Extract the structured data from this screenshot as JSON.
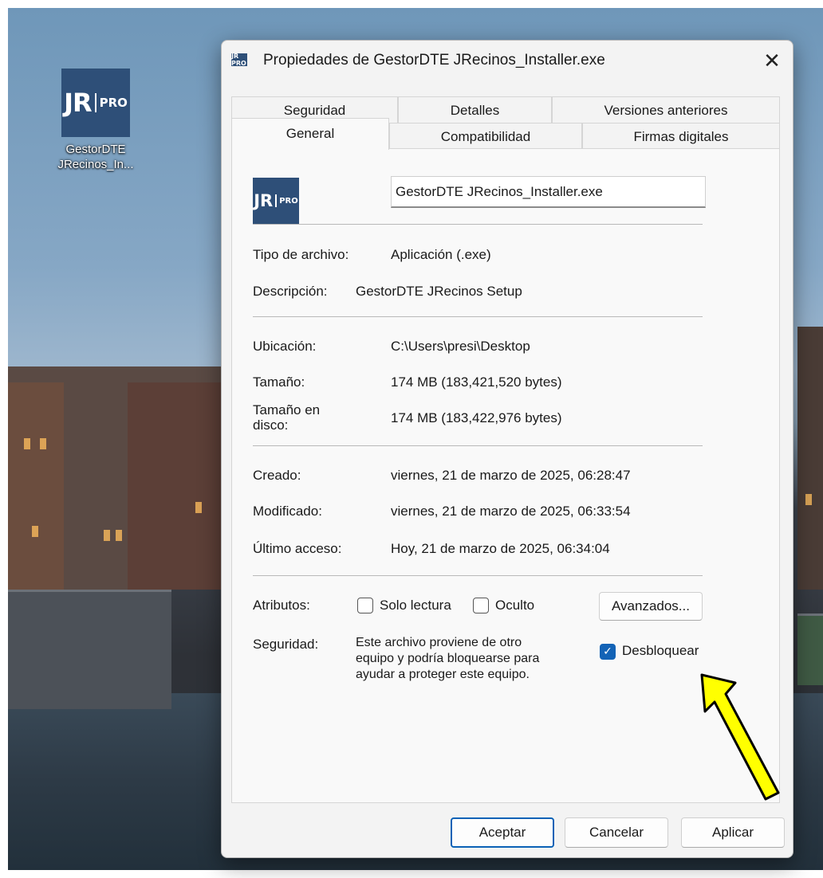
{
  "desktop": {
    "icon_tile": {
      "jr": "JR",
      "pro": "PRO"
    },
    "icon_label_line1": "GestorDTE",
    "icon_label_line2": "JRecinos_In..."
  },
  "dialog": {
    "title": "Propiedades de GestorDTE JRecinos_Installer.exe",
    "app_icon": "JR PRO",
    "close_glyph": "✕",
    "tabs_row1": [
      "Seguridad",
      "Detalles",
      "Versiones anteriores"
    ],
    "tabs_row2": [
      "General",
      "Compatibilidad",
      "Firmas digitales"
    ],
    "active_tab": "General",
    "general": {
      "file_icon": {
        "jr": "JR",
        "pro": "PRO"
      },
      "file_name": "GestorDTE JRecinos_Installer.exe",
      "type_label": "Tipo de archivo:",
      "type_value": "Aplicación (.exe)",
      "desc_label": "Descripción:",
      "desc_value": "GestorDTE JRecinos Setup",
      "location_label": "Ubicación:",
      "location_value": "C:\\Users\\presi\\Desktop",
      "size_label": "Tamaño:",
      "size_value": "174 MB (183,421,520 bytes)",
      "disk_size_label_1": "Tamaño en",
      "disk_size_label_2": "disco:",
      "disk_size_value": "174 MB (183,422,976 bytes)",
      "created_label": "Creado:",
      "created_value": "viernes, 21 de marzo de 2025, 06:28:47",
      "modified_label": "Modificado:",
      "modified_value": "viernes, 21 de marzo de 2025, 06:33:54",
      "accessed_label": "Último acceso:",
      "accessed_value": "Hoy, 21 de marzo de 2025, 06:34:04",
      "attributes_label": "Atributos:",
      "readonly_label": "Solo lectura",
      "readonly_checked": false,
      "hidden_label": "Oculto",
      "hidden_checked": false,
      "advanced_button": "Avanzados...",
      "security_label": "Seguridad:",
      "security_text_1": "Este archivo proviene de otro",
      "security_text_2": "equipo y podría bloquearse para",
      "security_text_3": "ayudar a proteger este equipo.",
      "unblock_label": "Desbloquear",
      "unblock_checked": true
    },
    "buttons": {
      "ok": "Aceptar",
      "cancel": "Cancelar",
      "apply": "Aplicar"
    }
  },
  "colors": {
    "accent": "#1363b6",
    "annotation_arrow": "#ffff00",
    "icon_bg": "#2e4f78"
  },
  "annotation": {
    "arrow_target": "unblock-checkbox",
    "arrow_color": "yellow"
  }
}
